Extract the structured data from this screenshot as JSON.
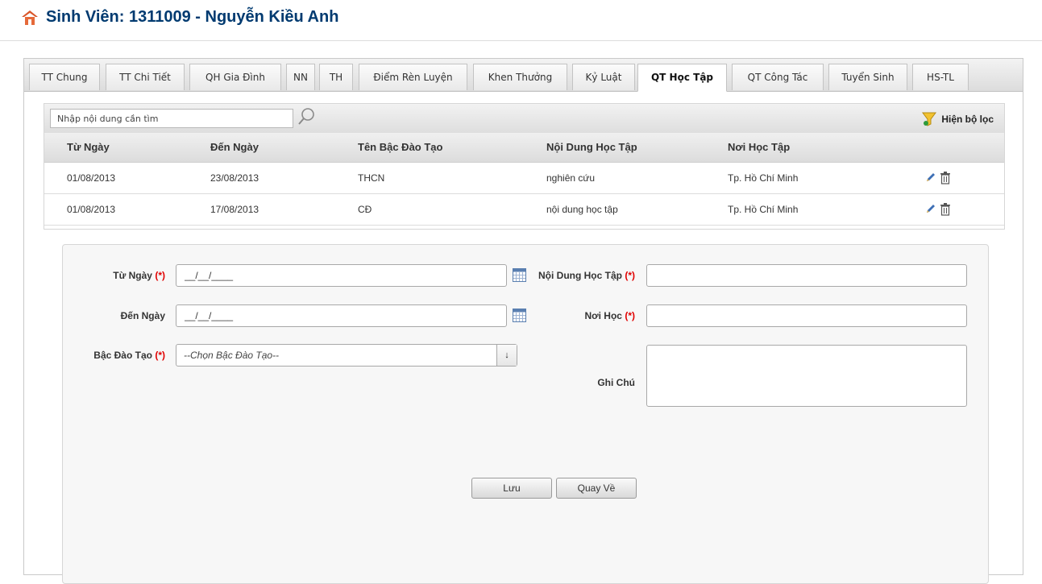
{
  "header": {
    "title": "Sinh Viên: 1311009 - Nguyễn Kiều Anh",
    "icon": "home-icon"
  },
  "tabs": [
    {
      "label": "TT Chung",
      "active": false
    },
    {
      "label": "TT Chi Tiết",
      "active": false
    },
    {
      "label": "QH Gia Đình",
      "active": false
    },
    {
      "label": "NN",
      "active": false
    },
    {
      "label": "TH",
      "active": false
    },
    {
      "label": "Điểm Rèn Luyện",
      "active": false
    },
    {
      "label": "Khen Thưởng",
      "active": false
    },
    {
      "label": "Kỷ Luật",
      "active": false
    },
    {
      "label": "QT Học Tập",
      "active": true
    },
    {
      "label": "QT Công Tác",
      "active": false
    },
    {
      "label": "Tuyển Sinh",
      "active": false
    },
    {
      "label": "HS-TL",
      "active": false
    }
  ],
  "toolbar": {
    "search_placeholder": "Nhập nội dung cần tìm",
    "search_icon": "magnifier-icon",
    "filter_label": "Hiện bộ lọc",
    "filter_icon": "funnel-icon"
  },
  "table": {
    "columns": [
      "Từ Ngày",
      "Đến Ngày",
      "Tên Bậc Đào Tạo",
      "Nội Dung Học Tập",
      "Nơi Học Tập"
    ],
    "rows": [
      [
        "01/08/2013",
        "23/08/2013",
        "THCN",
        "nghiên cứu",
        "Tp. Hồ Chí Minh"
      ],
      [
        "01/08/2013",
        "17/08/2013",
        "CĐ",
        "nội dung học tập",
        "Tp. Hồ Chí Minh"
      ]
    ],
    "row_actions": [
      "edit-icon",
      "delete-icon"
    ]
  },
  "form": {
    "required_mark": "(*)",
    "tu_ngay": {
      "label": "Từ Ngày",
      "value": "__/__/____",
      "icon": "calendar-icon"
    },
    "den_ngay": {
      "label": "Đến Ngày",
      "value": "__/__/____",
      "icon": "calendar-icon"
    },
    "bac_dao_tao": {
      "label": "Bậc Đào Tạo",
      "selected": "--Chọn Bậc Đào Tạo--"
    },
    "noi_dung": {
      "label": "Nội Dung Học Tập",
      "value": ""
    },
    "noi_hoc": {
      "label": "Nơi Học",
      "value": ""
    },
    "ghi_chu": {
      "label": "Ghi Chú",
      "value": ""
    },
    "save_label": "Lưu",
    "back_label": "Quay Về"
  },
  "colors": {
    "title": "#003a70",
    "required": "#e00000",
    "home_icon": "#d9572b"
  }
}
